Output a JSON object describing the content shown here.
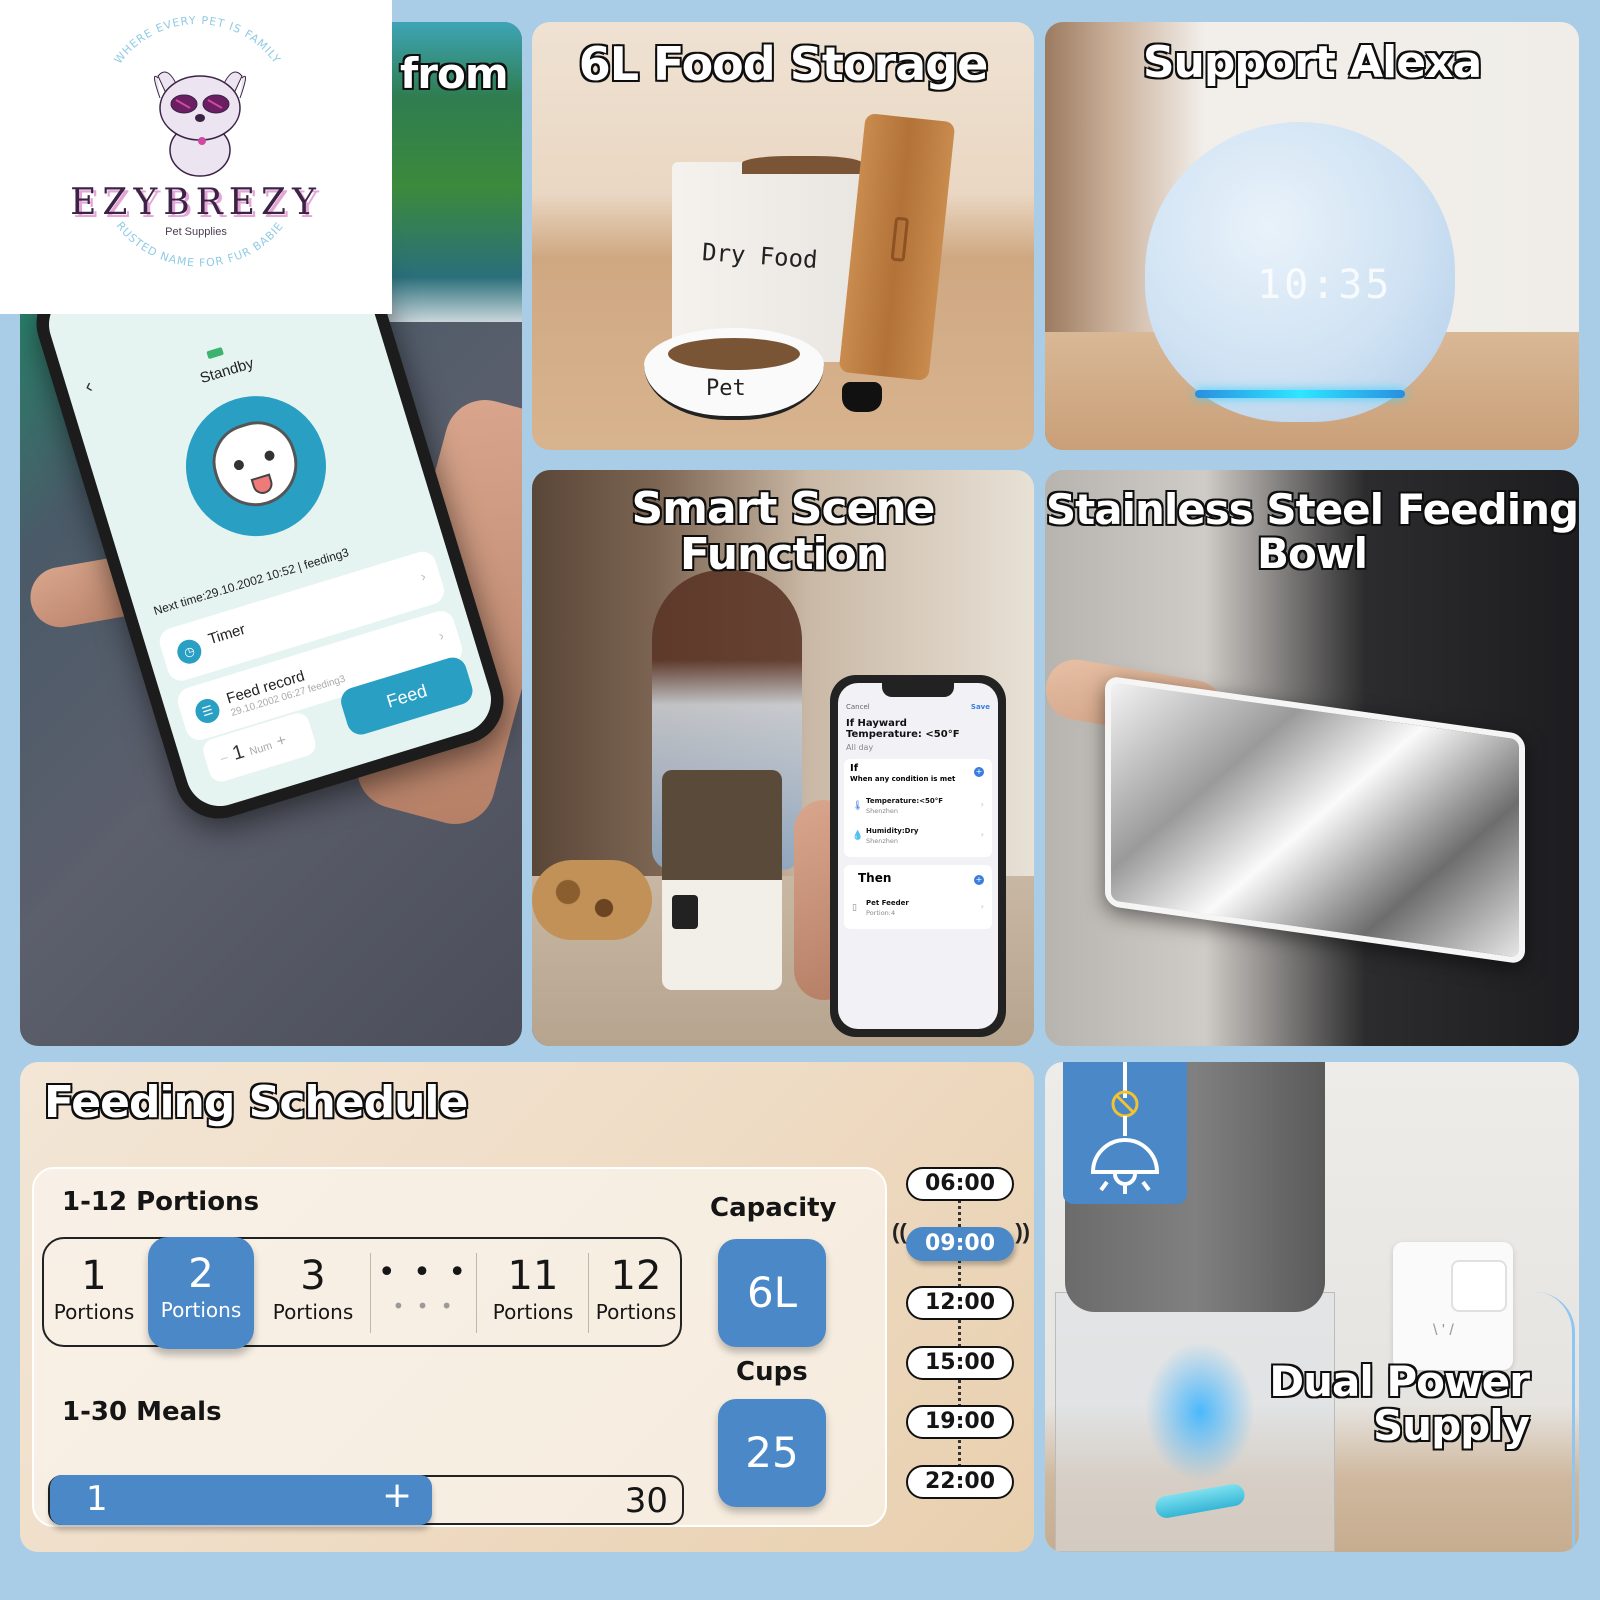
{
  "logo": {
    "brand": "EZYBREZY",
    "subtitle": "Pet Supplies",
    "tagline_top": "WHERE EVERY PET IS FAMILY",
    "tagline_bottom": "TRUSTED NAME FOR FUR BABIES",
    "accent_color": "#e4a5d6",
    "tagline_color": "#8fcbe6"
  },
  "tiles": {
    "app_control": {
      "title_fragment": "from",
      "app": {
        "status": "Standby",
        "next_time": "Next time:29.10.2002 10:52 | feeding3",
        "timer_label": "Timer",
        "feed_record_label": "Feed record",
        "feed_record_meta": "29.10.2002 06:27 feeding3",
        "num_value": "1",
        "num_unit": "Num",
        "num_minus": "−",
        "num_plus": "+",
        "feed_button": "Feed",
        "accent_color": "#2a9fc4"
      }
    },
    "food_storage": {
      "title": "6L Food Storage",
      "box_label": "Dry Food",
      "bowl_label": "Pet"
    },
    "alexa": {
      "title": "Support Alexa",
      "clock_display": "10:35"
    },
    "smart_scene": {
      "title": "Smart Scene Function",
      "phone": {
        "cancel": "Cancel",
        "save": "Save",
        "heading": "If Hayward Temperature: <50°F",
        "subheading": "All day",
        "if_label": "If",
        "if_condition": "When any condition is met",
        "conditions": [
          {
            "icon": "thermometer-icon",
            "title": "Temperature:<50°F",
            "location": "Shenzhen"
          },
          {
            "icon": "water-drop-icon",
            "title": "Humidity:Dry",
            "location": "Shenzhen"
          }
        ],
        "then_label": "Then",
        "actions": [
          {
            "icon": "pet-feeder-icon",
            "title": "Pet Feeder",
            "detail": "Portion:4"
          }
        ]
      }
    },
    "stainless": {
      "title_line1": "Stainless Steel Feeding",
      "title_line2": "Bowl"
    },
    "feeding_schedule": {
      "title": "Feeding Schedule",
      "portions_heading": "1-12 Portions",
      "portion_options": [
        {
          "number": "1",
          "unit": "Portions",
          "active": false
        },
        {
          "number": "2",
          "unit": "Portions",
          "active": true
        },
        {
          "number": "3",
          "unit": "Portions",
          "active": false
        },
        {
          "number": "• • •",
          "unit": "• • •",
          "active": false
        },
        {
          "number": "11",
          "unit": "Portions",
          "active": false
        },
        {
          "number": "12",
          "unit": "Portions",
          "active": false
        }
      ],
      "meals_heading": "1-30 Meals",
      "meals_min": "1",
      "meals_max": "30",
      "meals_plus": "+",
      "meals_fill_fraction": 0.6,
      "capacity_label": "Capacity",
      "capacity_value": "6L",
      "cups_label": "Cups",
      "cups_value": "25",
      "times": [
        "06:00",
        "09:00",
        "12:00",
        "15:00",
        "19:00",
        "22:00"
      ],
      "active_time": "09:00",
      "accent_color": "#4a88c8"
    },
    "dual_power": {
      "title_line1": "Dual Power",
      "title_line2": "Supply",
      "badge_icon": "pendant-lamp-no-power-icon"
    }
  }
}
